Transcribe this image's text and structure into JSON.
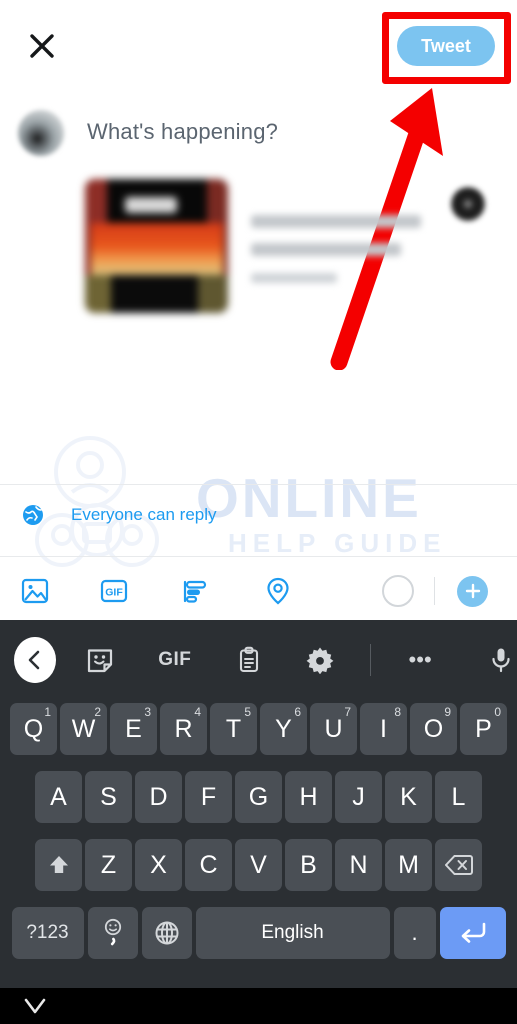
{
  "app": {
    "screen_name": "Twitter Compose Tweet"
  },
  "header": {
    "close_icon": "close-icon",
    "tweet_label": "Tweet",
    "tweet_button_color": "#7cc4f0",
    "tweet_text_color": "#ffffff"
  },
  "annotation": {
    "box_color": "#f40000",
    "arrow_color": "#f40000",
    "target": "Tweet"
  },
  "composer": {
    "avatar": "user-avatar",
    "placeholder": "What's happening?",
    "link_card": {
      "thumbnail": "link-thumbnail",
      "title_line_1": "",
      "title_line_2": "",
      "domain_line": "",
      "close_icon": "close-icon",
      "blurred": true
    }
  },
  "reply_settings": {
    "icon": "globe-icon",
    "label": "Everyone can reply",
    "color": "#1d9bf0"
  },
  "compose_toolbar": {
    "items": [
      {
        "name": "media-icon",
        "label": ""
      },
      {
        "name": "gif-icon",
        "label": "GIF"
      },
      {
        "name": "poll-icon",
        "label": ""
      },
      {
        "name": "location-icon",
        "label": ""
      }
    ],
    "char_counter": "",
    "plus_label": "+",
    "accent_color": "#1d9bf0",
    "plus_color": "#7cc4f0"
  },
  "watermark": {
    "line1": "ONLINE",
    "line2": "HELP GUIDE"
  },
  "keyboard": {
    "toolbar": {
      "back_icon": "chevron-left-icon",
      "sticker_icon": "sticker-icon",
      "gif_label": "GIF",
      "clipboard_icon": "clipboard-icon",
      "settings_icon": "gear-icon",
      "more_label": "•••",
      "mic_icon": "microphone-icon"
    },
    "row1": [
      {
        "letter": "Q",
        "digit": "1"
      },
      {
        "letter": "W",
        "digit": "2"
      },
      {
        "letter": "E",
        "digit": "3"
      },
      {
        "letter": "R",
        "digit": "4"
      },
      {
        "letter": "T",
        "digit": "5"
      },
      {
        "letter": "Y",
        "digit": "6"
      },
      {
        "letter": "U",
        "digit": "7"
      },
      {
        "letter": "I",
        "digit": "8"
      },
      {
        "letter": "O",
        "digit": "9"
      },
      {
        "letter": "P",
        "digit": "0"
      }
    ],
    "row2": [
      "A",
      "S",
      "D",
      "F",
      "G",
      "H",
      "J",
      "K",
      "L"
    ],
    "row3": {
      "shift_icon": "shift-icon",
      "letters": [
        "Z",
        "X",
        "C",
        "V",
        "B",
        "N",
        "M"
      ],
      "backspace_icon": "backspace-icon"
    },
    "row4": {
      "symbols_label": "?123",
      "emoji_label": ",",
      "emoji_icon": "emoji-icon",
      "globe_icon": "globe-key-icon",
      "space_label": "English",
      "period_label": ".",
      "enter_icon": "enter-icon",
      "enter_color": "#6c9bf5"
    },
    "background_color": "#2b2f33",
    "key_color": "#4a4f55"
  },
  "navbar": {
    "back_icon": "nav-back-icon",
    "background_color": "#000000"
  }
}
